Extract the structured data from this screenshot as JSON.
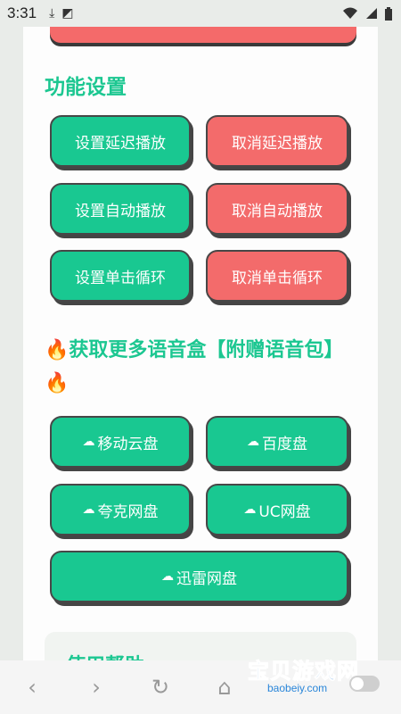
{
  "status_bar": {
    "time": "3:31"
  },
  "section_settings": {
    "title": "功能设置",
    "buttons": [
      {
        "label": "设置延迟播放"
      },
      {
        "label": "取消延迟播放"
      },
      {
        "label": "设置自动播放"
      },
      {
        "label": "取消自动播放"
      },
      {
        "label": "设置单击循环"
      },
      {
        "label": "取消单击循环"
      }
    ]
  },
  "section_download": {
    "title": "🔥获取更多语音盒【附赠语音包】🔥",
    "buttons": [
      {
        "label": "移动云盘"
      },
      {
        "label": "百度盘"
      },
      {
        "label": "夸克网盘"
      },
      {
        "label": "UC网盘"
      },
      {
        "label": "迅雷网盘"
      }
    ]
  },
  "help": {
    "title": "使用帮助"
  },
  "watermark": {
    "text": "宝贝游戏网",
    "url": "baobeiy.com"
  },
  "colors": {
    "green": "#19c891",
    "red": "#f36b6b",
    "title": "#1cc791"
  },
  "icons": [
    "download-icon",
    "app-icon",
    "wifi-icon",
    "signal-icon",
    "battery-icon",
    "cloud-icon",
    "back-icon",
    "forward-icon",
    "refresh-icon",
    "home-icon"
  ]
}
